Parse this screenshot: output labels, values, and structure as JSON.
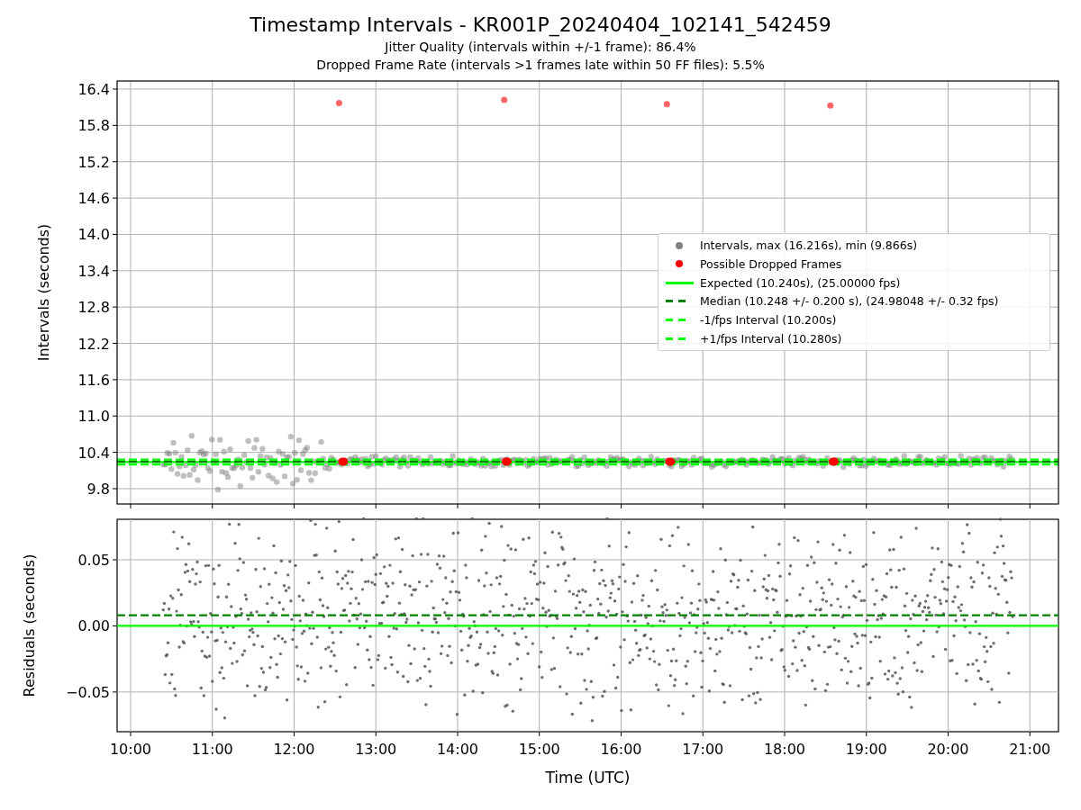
{
  "title": "Timestamp Intervals - KR001P_20240404_102141_542459",
  "subtitles": [
    "Jitter Quality (intervals within +/-1 frame): 86.4%",
    "Dropped Frame Rate (intervals >1 frames late within 50 FF files): 5.5%"
  ],
  "top_chart": {
    "legend": [
      {
        "kind": "marker",
        "label": "Intervals, max (16.216s), min (9.866s)",
        "color": "#808080"
      },
      {
        "kind": "marker",
        "label": "Possible Dropped Frames",
        "color": "#ff0000"
      },
      {
        "kind": "solid",
        "label": "Expected (10.240s), (25.00000 fps)",
        "color": "#00ff00"
      },
      {
        "kind": "dashed",
        "label": "Median (10.248 +/- 0.200 s), (24.98048 +/- 0.32 fps)",
        "color": "#008000"
      },
      {
        "kind": "dashed",
        "label": "-1/fps Interval (10.200s)",
        "color": "#00ff00"
      },
      {
        "kind": "dashed",
        "label": "+1/fps Interval (10.280s)",
        "color": "#00ff00"
      }
    ],
    "chart_data": {
      "type": "scatter",
      "ylabel": "Intervals (seconds)",
      "xlim": [
        9.835,
        21.35
      ],
      "ylim": [
        9.547,
        16.534
      ],
      "grid": true,
      "yticks": [
        {
          "value": 9.8,
          "label": "9.8"
        },
        {
          "value": 10.4,
          "label": "10.4"
        },
        {
          "value": 11.0,
          "label": "11.0"
        },
        {
          "value": 11.6,
          "label": "11.6"
        },
        {
          "value": 12.2,
          "label": "12.2"
        },
        {
          "value": 12.8,
          "label": "12.8"
        },
        {
          "value": 13.4,
          "label": "13.4"
        },
        {
          "value": 14.0,
          "label": "14.0"
        },
        {
          "value": 14.6,
          "label": "14.6"
        },
        {
          "value": 15.2,
          "label": "15.2"
        },
        {
          "value": 15.8,
          "label": "15.8"
        },
        {
          "value": 16.4,
          "label": "16.4"
        }
      ],
      "series": [
        {
          "color": "#ff0000",
          "x": [
            12.55,
            14.57,
            16.56,
            18.56
          ],
          "values": [
            16.17,
            16.22,
            16.15,
            16.13
          ]
        }
      ],
      "ref_lines": [
        {
          "axis": "y",
          "value": 10.24,
          "color": "#00ff00"
        },
        {
          "axis": "y",
          "value": 10.248,
          "color": "#008000"
        },
        {
          "axis": "y",
          "value": 10.2,
          "color": "#00ff00"
        },
        {
          "axis": "y",
          "value": 10.28,
          "color": "#00ff00"
        }
      ]
    }
  },
  "bottom_chart": {
    "chart_data": {
      "type": "scatter",
      "xlabel": "Time (UTC)",
      "ylabel": "Residuals (seconds)",
      "xlim": [
        9.835,
        21.35
      ],
      "ylim": [
        -0.08,
        0.0806
      ],
      "grid": true,
      "yticks": [
        {
          "value": 0.05,
          "label": "0.05"
        },
        {
          "value": 0,
          "label": "0.00"
        },
        {
          "value": -0.05,
          "label": "−0.05"
        }
      ],
      "xticks": [
        {
          "value": 10,
          "label": "10:00"
        },
        {
          "value": 11,
          "label": "11:00"
        },
        {
          "value": 12,
          "label": "12:00"
        },
        {
          "value": 13,
          "label": "13:00"
        },
        {
          "value": 14,
          "label": "14:00"
        },
        {
          "value": 15,
          "label": "15:00"
        },
        {
          "value": 16,
          "label": "16:00"
        },
        {
          "value": 17,
          "label": "17:00"
        },
        {
          "value": 18,
          "label": "18:00"
        },
        {
          "value": 19,
          "label": "19:00"
        },
        {
          "value": 20,
          "label": "20:00"
        },
        {
          "value": 21,
          "label": "21:00"
        }
      ],
      "ref_lines": [
        {
          "axis": "y",
          "value": 0.008,
          "color": "#008000"
        },
        {
          "axis": "y",
          "value": 0,
          "color": "#00ff00"
        }
      ]
    }
  }
}
